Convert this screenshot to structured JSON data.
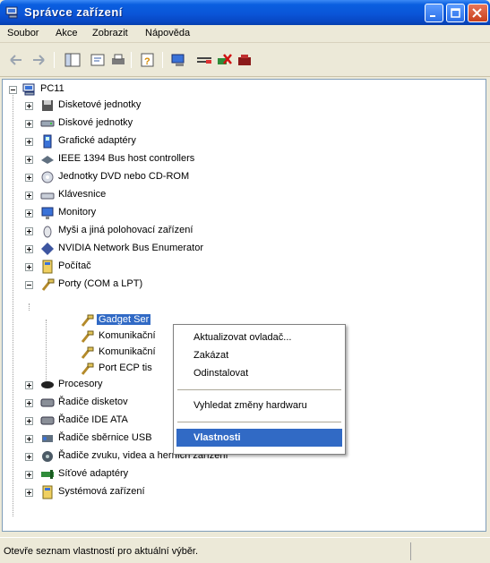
{
  "window": {
    "title": "Správce zařízení"
  },
  "menubar": {
    "items": [
      "Soubor",
      "Akce",
      "Zobrazit",
      "Nápověda"
    ]
  },
  "tree": {
    "root": "PC11",
    "categories": [
      {
        "label": "Disketové jednotky",
        "icon": "floppy-icon"
      },
      {
        "label": "Diskové jednotky",
        "icon": "disk-drive-icon"
      },
      {
        "label": "Grafické adaptéry",
        "icon": "display-adapter-icon"
      },
      {
        "label": "IEEE 1394 Bus host controllers",
        "icon": "ieee1394-icon"
      },
      {
        "label": "Jednotky DVD nebo CD-ROM",
        "icon": "cdrom-icon"
      },
      {
        "label": "Klávesnice",
        "icon": "keyboard-icon"
      },
      {
        "label": "Monitory",
        "icon": "monitor-icon"
      },
      {
        "label": "Myši a jiná polohovací zařízení",
        "icon": "mouse-icon"
      },
      {
        "label": "NVIDIA Network Bus Enumerator",
        "icon": "network-bus-icon"
      },
      {
        "label": "Počítač",
        "icon": "computer-icon"
      },
      {
        "label": "Porty (COM a LPT)",
        "icon": "port-icon"
      }
    ],
    "port_children": [
      "Gadget Ser",
      "Komunikační",
      "Komunikační",
      "Port ECP tis"
    ],
    "categories_after": [
      {
        "label": "Procesory",
        "icon": "processor-icon"
      },
      {
        "label": "Řadiče disketov",
        "icon": "floppy-controller-icon"
      },
      {
        "label": "Řadiče IDE ATA",
        "icon": "ide-controller-icon"
      },
      {
        "label": "Řadiče sběrnice USB",
        "icon": "usb-icon"
      },
      {
        "label": "Řadiče zvuku, videa a herních zařízení",
        "icon": "sound-icon"
      },
      {
        "label": "Síťové adaptéry",
        "icon": "network-adapter-icon"
      },
      {
        "label": "Systémová zařízení",
        "icon": "system-icon"
      }
    ]
  },
  "context_menu": {
    "update_driver": "Aktualizovat ovladač...",
    "disable": "Zakázat",
    "uninstall": "Odinstalovat",
    "scan_hardware": "Vyhledat změny hardwaru",
    "properties": "Vlastnosti"
  },
  "statusbar": {
    "text": "Otevře seznam vlastností pro aktuální výběr."
  },
  "colors": {
    "selection": "#316ac5",
    "titlebar": "#0a55d8",
    "face": "#ece9d8"
  }
}
